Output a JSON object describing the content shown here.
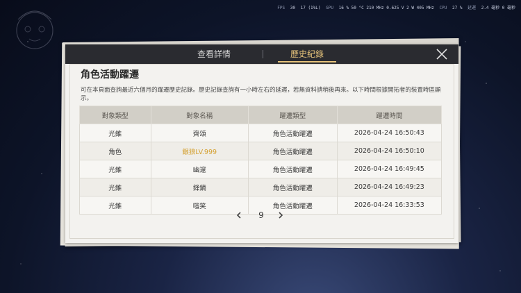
{
  "perf": {
    "fps_label": "FPS",
    "fps_value": "30",
    "fps_low": "17 (1%L)",
    "gpu_label": "GPU",
    "gpu_stats": "16 % 50 °C 210 MHz 0.625 V 2 W 405 MHz",
    "cpu_label": "CPU",
    "cpu_stats": "27 %",
    "latency_label": "延遲",
    "latency_stats": "2.4 毫秒 0 毫秒"
  },
  "tabs": {
    "details": "查看詳情",
    "history": "歷史紀錄"
  },
  "section_title": "角色活動躍遷",
  "description": "可在本頁面查詢最近六個月的躍遷歷史記錄。歷史記錄查詢有一小時左右的延遲，若無資料請稍後再來。以下時間根據開拓者的裝置時區顯示。",
  "table": {
    "headers": [
      "對象類型",
      "對象名稱",
      "躍遷類型",
      "躍遷時間"
    ],
    "rows": [
      {
        "type": "光錐",
        "name": "齊頌",
        "warp": "角色活動躍遷",
        "time": "2026-04-24 16:50:43",
        "highlight": false
      },
      {
        "type": "角色",
        "name": "銀狼LV.999",
        "warp": "角色活動躍遷",
        "time": "2026-04-24 16:50:10",
        "highlight": true
      },
      {
        "type": "光錐",
        "name": "幽邃",
        "warp": "角色活動躍遷",
        "time": "2026-04-24 16:49:45",
        "highlight": false
      },
      {
        "type": "光錐",
        "name": "鋒鏑",
        "warp": "角色活動躍遷",
        "time": "2026-04-24 16:49:23",
        "highlight": false
      },
      {
        "type": "光錐",
        "name": "嗤笑",
        "warp": "角色活動躍遷",
        "time": "2026-04-24 16:33:53",
        "highlight": false
      }
    ]
  },
  "pagination": {
    "page": "9"
  },
  "colors": {
    "accent_gold": "#e6c37a",
    "highlight_name": "#d4a030",
    "tab_bar": "#2a2b30"
  }
}
